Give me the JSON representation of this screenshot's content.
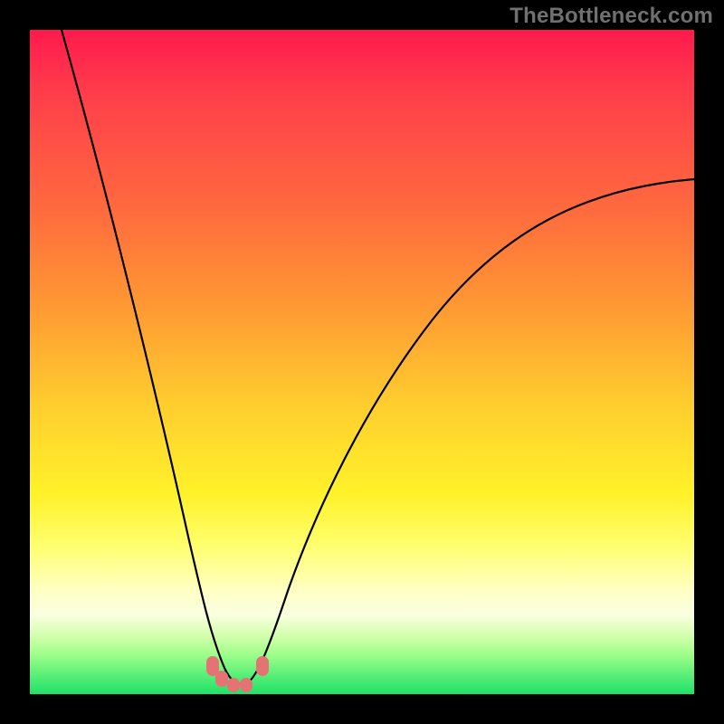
{
  "watermark": "TheBottleneck.com",
  "chart_data": {
    "type": "line",
    "title": "",
    "xlabel": "",
    "ylabel": "",
    "xlim": [
      0,
      1
    ],
    "ylim": [
      0,
      1
    ],
    "series": [
      {
        "name": "bottleneck-curve",
        "x": [
          0.0,
          0.05,
          0.1,
          0.15,
          0.2,
          0.24,
          0.27,
          0.29,
          0.31,
          0.33,
          0.36,
          0.39,
          0.43,
          0.5,
          0.6,
          0.7,
          0.8,
          0.9,
          1.0
        ],
        "y": [
          1.0,
          0.8,
          0.6,
          0.42,
          0.25,
          0.12,
          0.05,
          0.02,
          0.01,
          0.02,
          0.05,
          0.12,
          0.22,
          0.37,
          0.52,
          0.62,
          0.69,
          0.74,
          0.77
        ]
      }
    ],
    "annotations": {
      "markers": [
        {
          "x": 0.272,
          "y": 0.045
        },
        {
          "x": 0.285,
          "y": 0.02
        },
        {
          "x": 0.3,
          "y": 0.01
        },
        {
          "x": 0.315,
          "y": 0.01
        },
        {
          "x": 0.345,
          "y": 0.04
        }
      ]
    },
    "colors": {
      "gradient_top": "#ff1a4d",
      "gradient_mid": "#fff22a",
      "gradient_bottom": "#1fe068",
      "curve": "#000000",
      "markers": "#e57373"
    }
  }
}
